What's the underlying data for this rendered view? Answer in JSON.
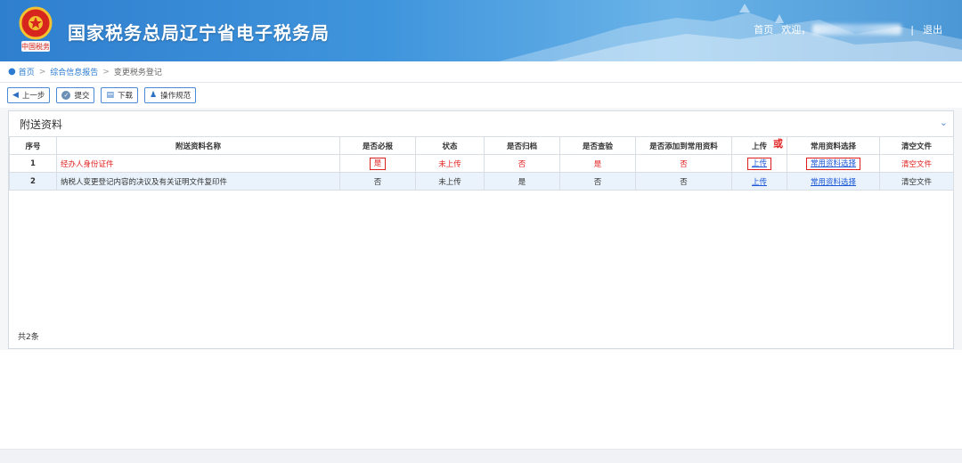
{
  "header": {
    "title": "国家税务总局辽宁省电子税务局",
    "emblem_text": "中国税务",
    "nav_home": "首页",
    "nav_welcome": "欢迎，",
    "nav_separator": "|",
    "nav_logout": "退出"
  },
  "breadcrumb": {
    "home": "首页",
    "level2": "综合信息报告",
    "current": "变更税务登记",
    "separator": ">"
  },
  "toolbar": {
    "prev": "上一步",
    "submit": "提交",
    "download": "下载",
    "guide": "操作规范"
  },
  "panel": {
    "title": "附送资料",
    "total": "共2条",
    "or_mark": "或"
  },
  "table": {
    "headers": [
      "序号",
      "附送资料名称",
      "是否必报",
      "状态",
      "是否归档",
      "是否查验",
      "是否添加到常用资料",
      "上传",
      "常用资料选择",
      "清空文件"
    ],
    "rows": [
      {
        "index": "1",
        "name": "经办人身份证件",
        "required": "是",
        "status": "未上传",
        "archived": "否",
        "verified": "是",
        "added_common": "否",
        "upload": "上传",
        "common_select": "常用资料选择",
        "clear": "清空文件"
      },
      {
        "index": "2",
        "name": "纳税人变更登记内容的决议及有关证明文件复印件",
        "required": "否",
        "status": "未上传",
        "archived": "是",
        "verified": "否",
        "added_common": "否",
        "upload": "上传",
        "common_select": "常用资料选择",
        "clear": "清空文件"
      }
    ]
  },
  "colors": {
    "header_blue": "#3f95dc",
    "link_blue": "#1a56d6",
    "highlight_red": "#e02020",
    "alt_row": "#eaf3fb"
  }
}
